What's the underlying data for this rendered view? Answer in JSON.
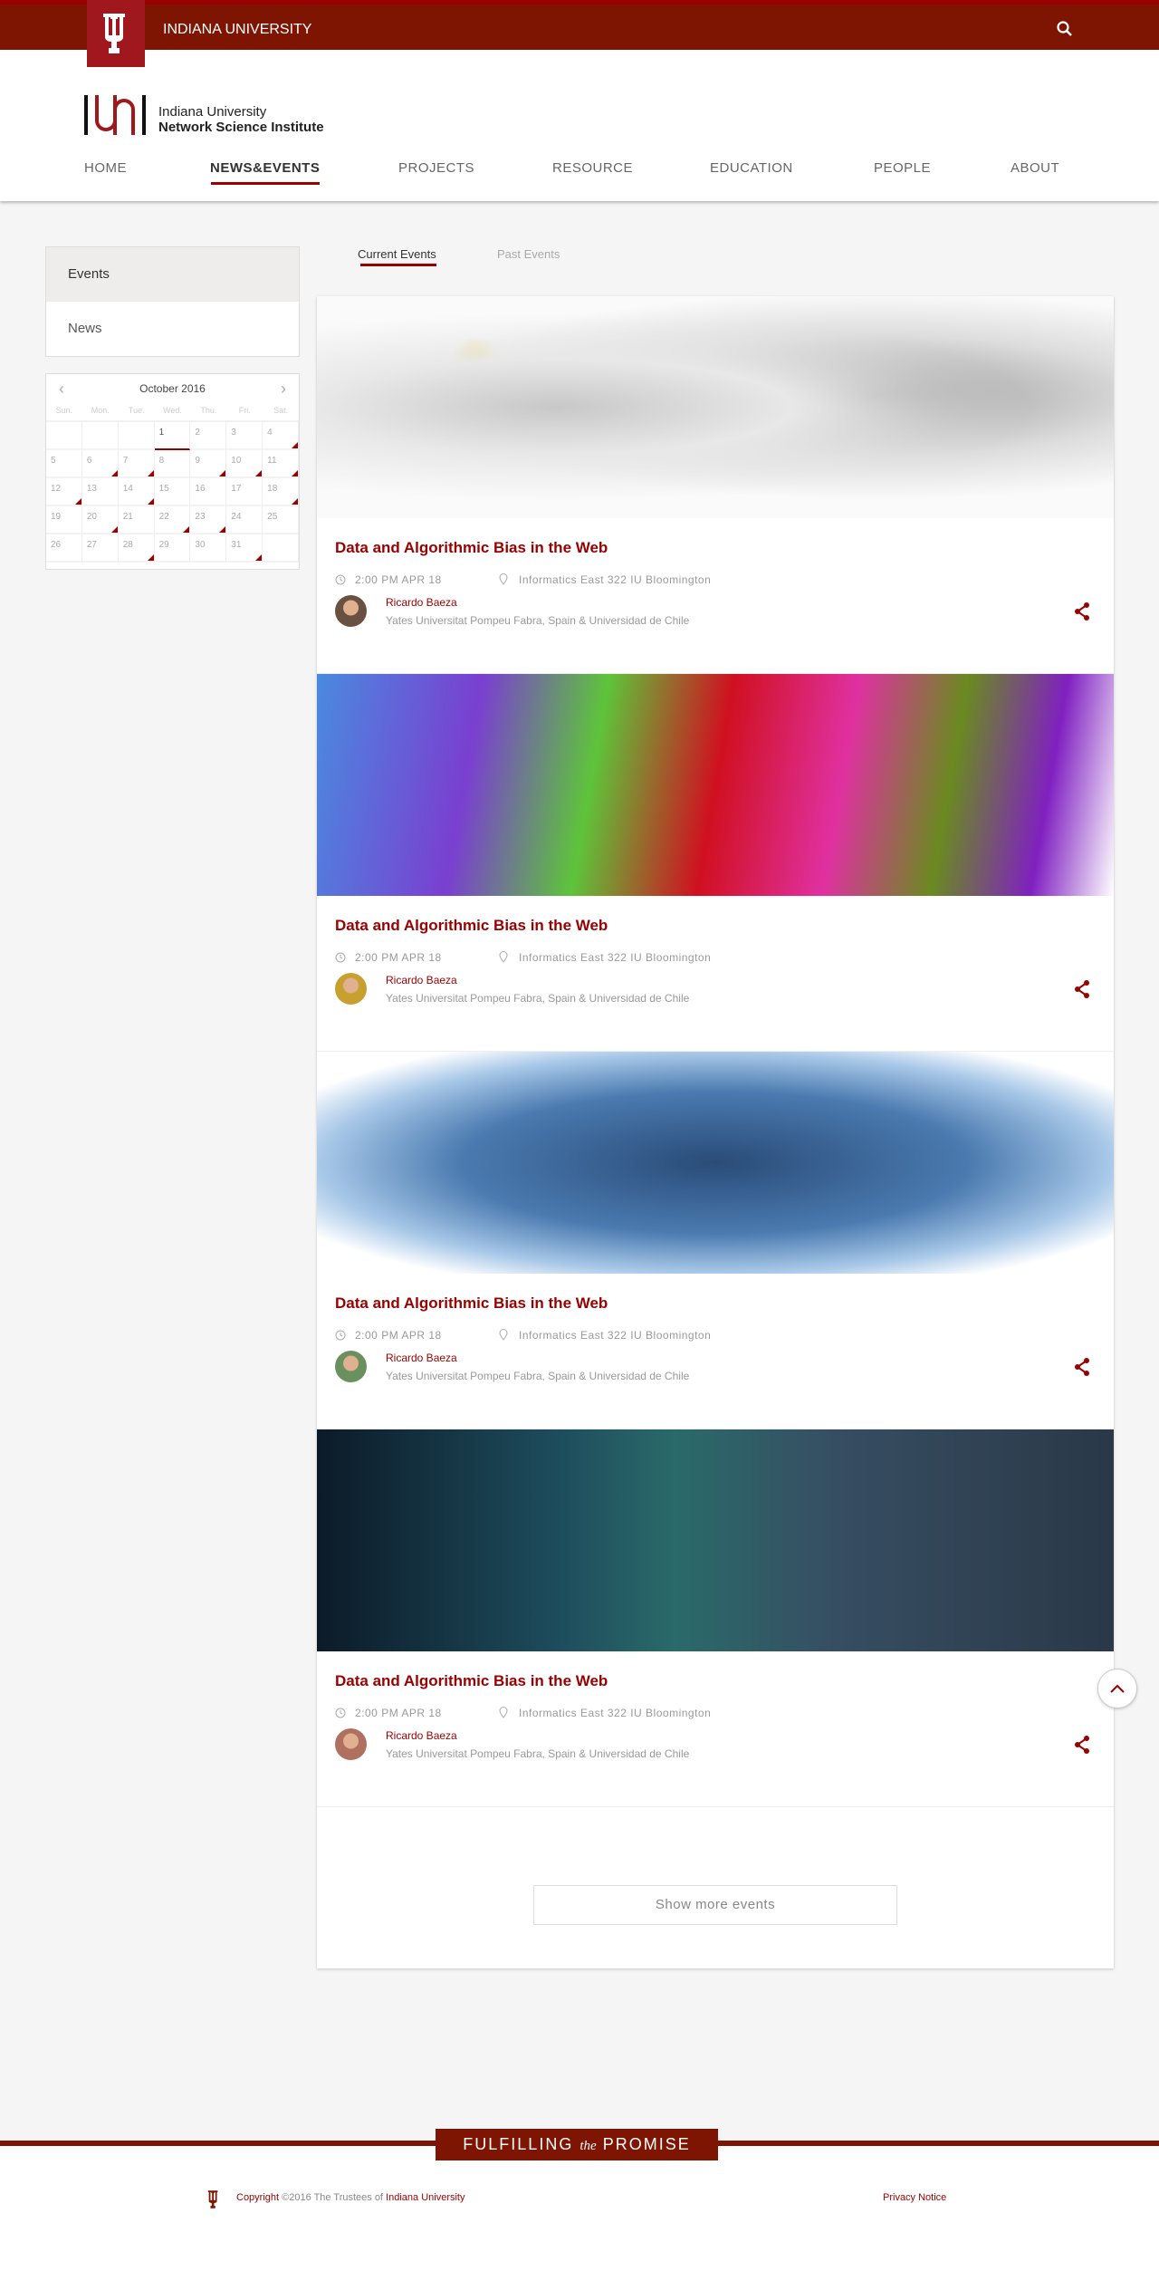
{
  "topbar": {
    "title": "INDIANA UNIVERSITY",
    "search_icon": "search-icon"
  },
  "logo": {
    "line1": "Indiana University",
    "line2": "Network Science Institute"
  },
  "nav": [
    "HOME",
    "NEWS&EVENTS",
    "PROJECTS",
    "RESOURCE",
    "EDUCATION",
    "PEOPLE",
    "ABOUT"
  ],
  "nav_active": "NEWS&EVENTS",
  "sidebar": {
    "items": [
      "Events",
      "News"
    ],
    "selected": "Events"
  },
  "calendar": {
    "month": "October 2016",
    "weekdays": [
      "Sun.",
      "Mon.",
      "Tue.",
      "Wed.",
      "Thu.",
      "Fri.",
      "Sat."
    ],
    "today": 1,
    "event_days": [
      4,
      6,
      7,
      9,
      10,
      11,
      12,
      14,
      18,
      20,
      22,
      23,
      28,
      31
    ]
  },
  "tabs": [
    "Current Events",
    "Past Events"
  ],
  "events": [
    {
      "title": "Data and Algorithmic Bias in the Web",
      "time": "2:00 PM  APR 18",
      "location": "Informatics East 322  IU Bloomington",
      "speaker": "Ricardo Baeza",
      "affiliation": "Yates Universitat Pompeu Fabra, Spain & Universidad de Chile"
    },
    {
      "title": "Data and Algorithmic Bias in the Web",
      "time": "2:00 PM  APR 18",
      "location": "Informatics East 322  IU Bloomington",
      "speaker": "Ricardo Baeza",
      "affiliation": "Yates Universitat Pompeu Fabra, Spain & Universidad de Chile"
    },
    {
      "title": "Data and Algorithmic Bias in the Web",
      "time": "2:00 PM  APR 18",
      "location": "Informatics East 322  IU Bloomington",
      "speaker": "Ricardo Baeza",
      "affiliation": "Yates Universitat Pompeu Fabra, Spain & Universidad de Chile"
    },
    {
      "title": "Data and Algorithmic Bias in the Web",
      "time": "2:00 PM  APR 18",
      "location": "Informatics East 322  IU Bloomington",
      "speaker": "Ricardo Baeza",
      "affiliation": "Yates Universitat Pompeu Fabra, Spain & Universidad de Chile"
    }
  ],
  "show_more": "Show more events",
  "footer": {
    "badge_left": "FULFILLING",
    "badge_mid": "the",
    "badge_right": "PROMISE",
    "copyright_link": "Copyright",
    "copyright_text": " ©2016 The Trustees of ",
    "iu_link": "Indiana University",
    "privacy": "Privacy Notice"
  },
  "colors": {
    "brand": "#7e1502",
    "accent": "#990000"
  }
}
